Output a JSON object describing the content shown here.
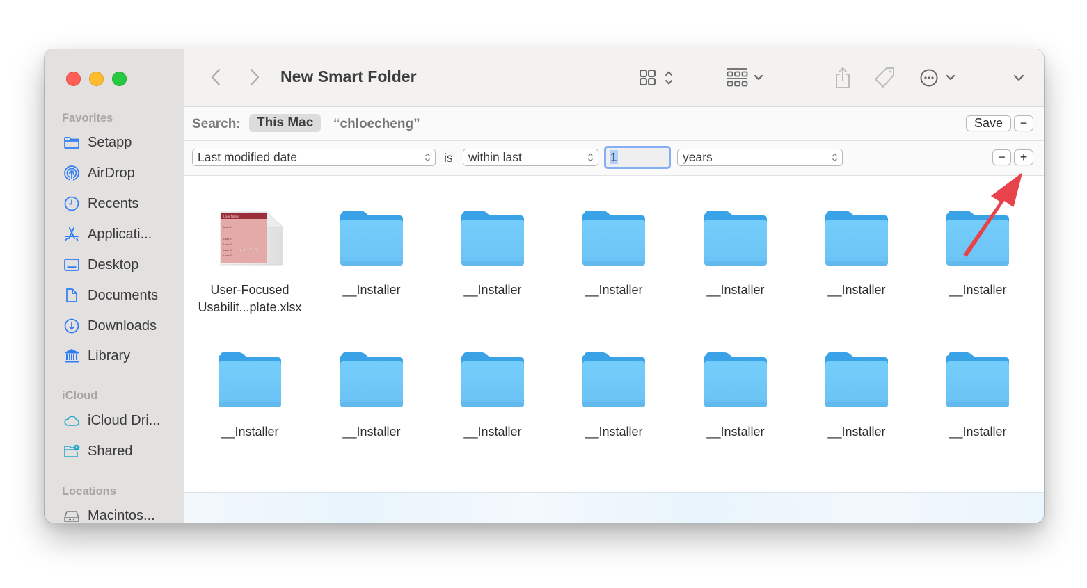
{
  "window": {
    "title": "New Smart Folder",
    "traffic_lights": [
      "close",
      "minimize",
      "zoom"
    ]
  },
  "sidebar": {
    "sections": [
      {
        "title": "Favorites",
        "items": [
          {
            "label": "Setapp",
            "icon": "folder-icon"
          },
          {
            "label": "AirDrop",
            "icon": "airdrop-icon"
          },
          {
            "label": "Recents",
            "icon": "clock-icon"
          },
          {
            "label": "Applicati...",
            "icon": "applications-icon"
          },
          {
            "label": "Desktop",
            "icon": "desktop-icon"
          },
          {
            "label": "Documents",
            "icon": "document-icon"
          },
          {
            "label": "Downloads",
            "icon": "download-icon"
          },
          {
            "label": "Library",
            "icon": "library-icon"
          }
        ]
      },
      {
        "title": "iCloud",
        "items": [
          {
            "label": "iCloud Dri...",
            "icon": "cloud-icon"
          },
          {
            "label": "Shared",
            "icon": "shared-folder-icon"
          }
        ]
      },
      {
        "title": "Locations",
        "items": [
          {
            "label": "Macintos...",
            "icon": "disk-icon"
          }
        ]
      }
    ]
  },
  "toolbar": {
    "back": "back-chevron-icon",
    "forward": "forward-chevron-icon",
    "view_mode": "icon-grid-icon",
    "group": "group-by-icon",
    "share": "share-icon",
    "tags": "tag-icon",
    "more": "ellipsis-circle-icon",
    "search": "search-icon"
  },
  "search_bar": {
    "label": "Search:",
    "scopes": [
      {
        "label": "This Mac",
        "active": true
      },
      {
        "label": "“chloecheng”",
        "active": false
      }
    ],
    "save_label": "Save",
    "remove_label": "−"
  },
  "criteria": {
    "attribute": "Last modified date",
    "operator_text": "is",
    "comparison": "within last",
    "value": "1",
    "unit": "years",
    "remove_label": "−",
    "add_label": "+"
  },
  "files": [
    {
      "name_line1": "User-Focused",
      "name_line2": "Usabilit...plate.xlsx",
      "type": "xlsx",
      "badge": "XLSX",
      "thumb_rows": [
        "User Name",
        "User 1",
        "User 2",
        "User 3",
        "User 4",
        "User 5"
      ]
    },
    {
      "name_line1": "__Installer",
      "type": "folder"
    },
    {
      "name_line1": "__Installer",
      "type": "folder"
    },
    {
      "name_line1": "__Installer",
      "type": "folder"
    },
    {
      "name_line1": "__Installer",
      "type": "folder"
    },
    {
      "name_line1": "__Installer",
      "type": "folder"
    },
    {
      "name_line1": "__Installer",
      "type": "folder"
    },
    {
      "name_line1": "__Installer",
      "type": "folder"
    },
    {
      "name_line1": "__Installer",
      "type": "folder"
    },
    {
      "name_line1": "__Installer",
      "type": "folder"
    },
    {
      "name_line1": "__Installer",
      "type": "folder"
    },
    {
      "name_line1": "__Installer",
      "type": "folder"
    },
    {
      "name_line1": "__Installer",
      "type": "folder"
    },
    {
      "name_line1": "__Installer",
      "type": "folder"
    }
  ],
  "annotation": {
    "type": "arrow",
    "color": "#e8424a",
    "points_to": "add-criteria-button"
  },
  "colors": {
    "accent": "#2f7cf6",
    "folder": "#6ec6f8",
    "folder_tab": "#3aa3e8",
    "sidebar_bg": "#e3e1e0"
  }
}
